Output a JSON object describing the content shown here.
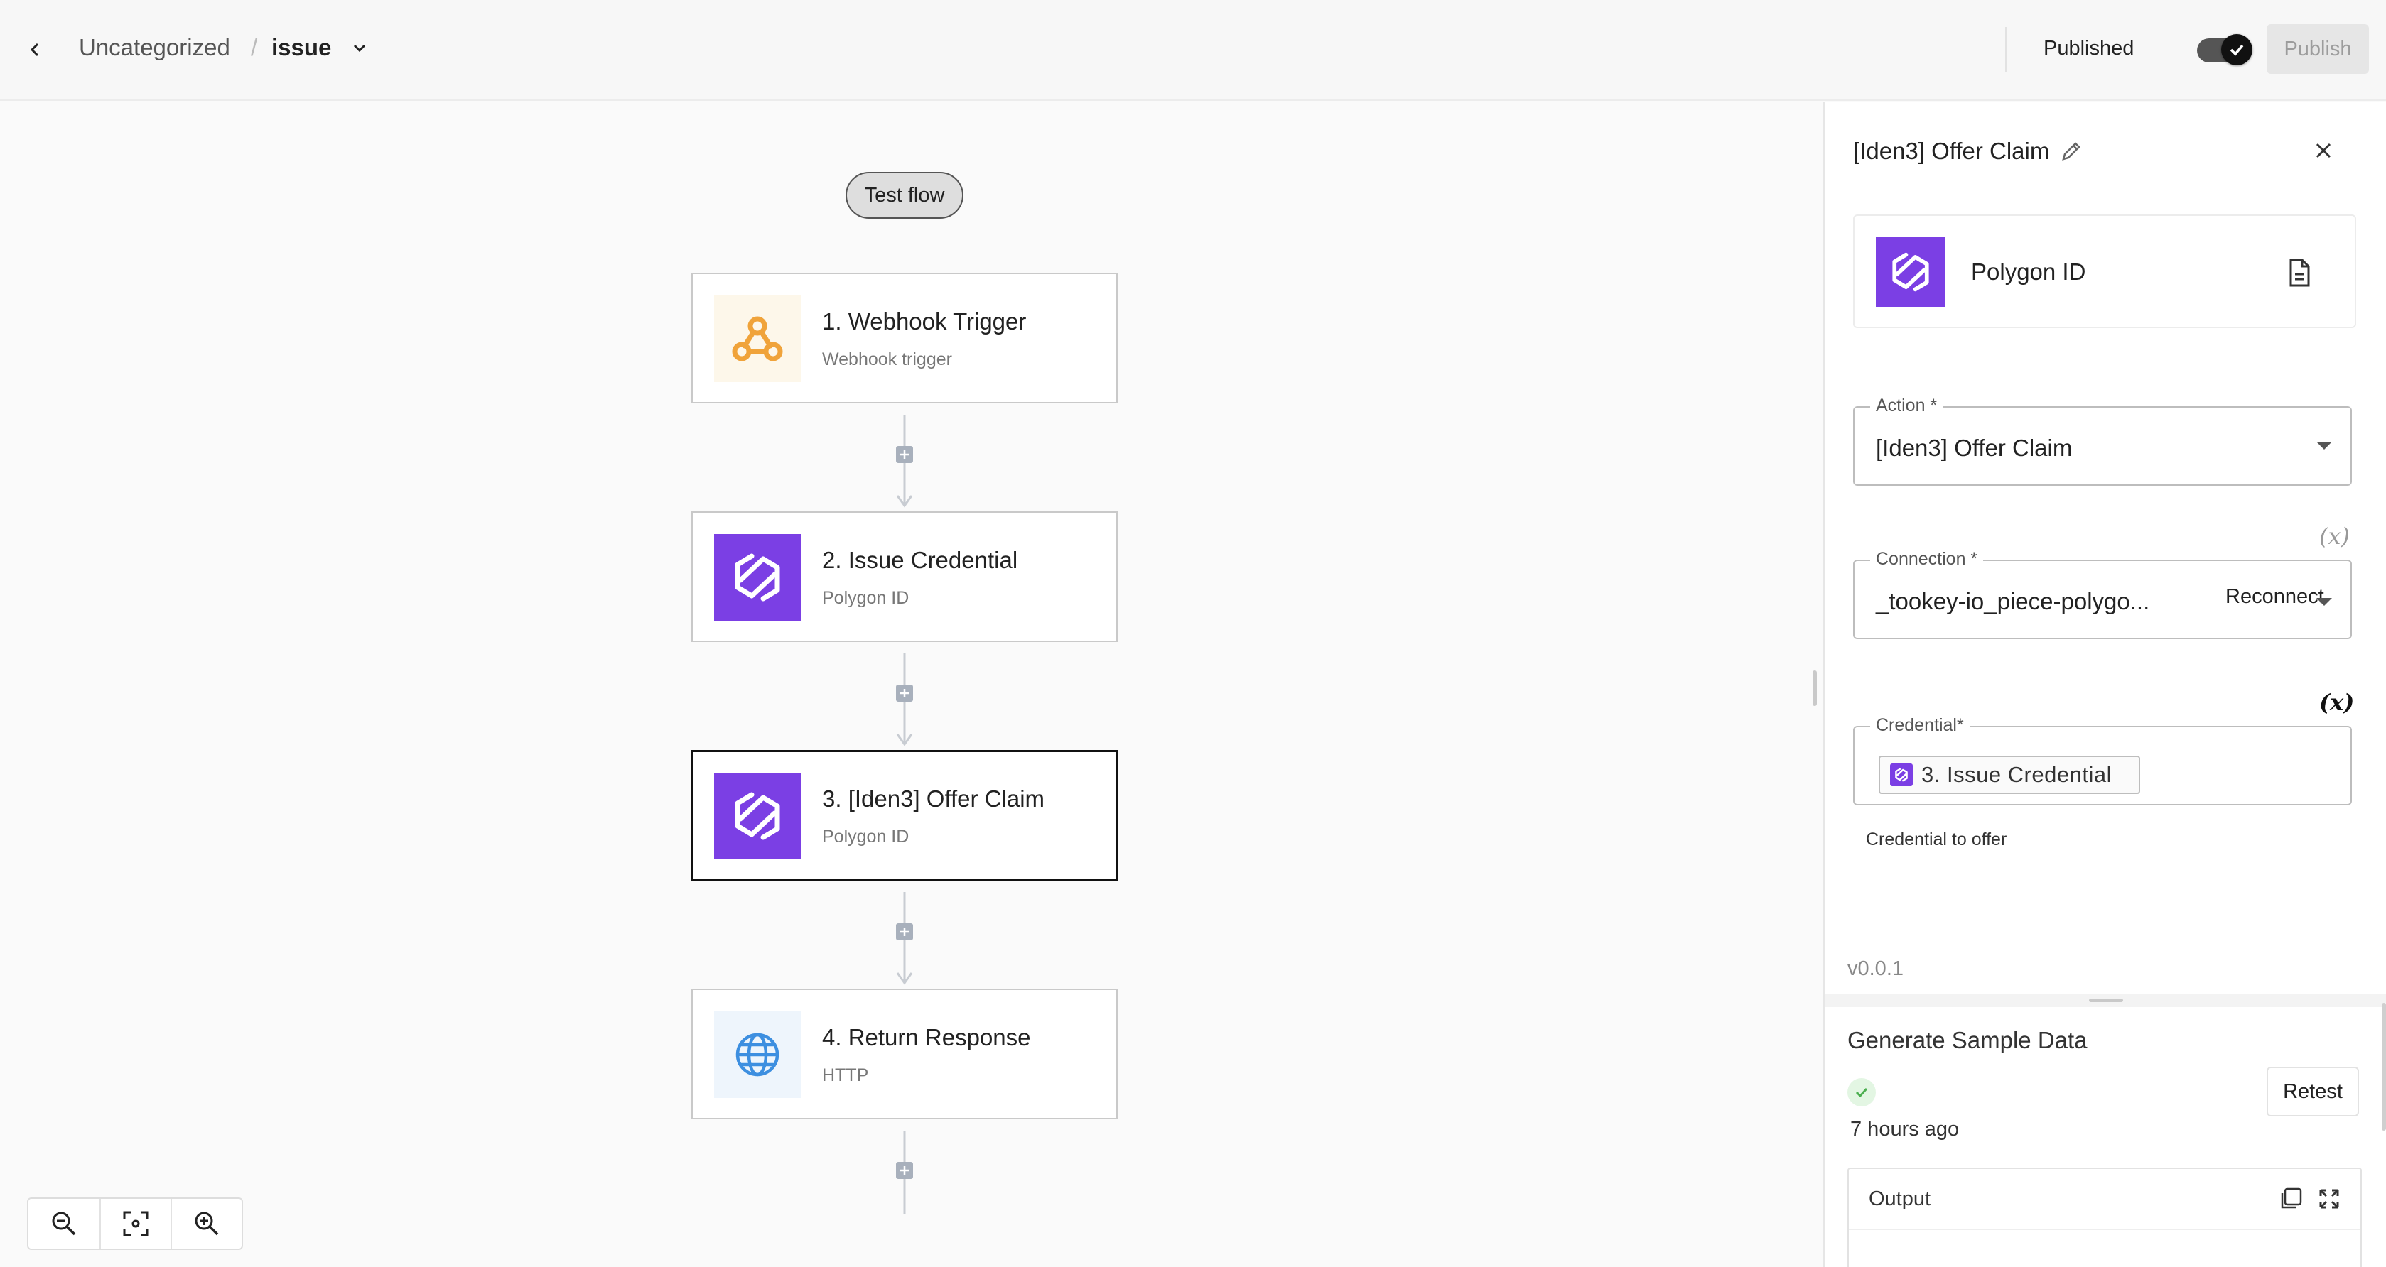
{
  "header": {
    "folder": "Uncategorized",
    "separator": "/",
    "flow_name": "issue",
    "status": "Published",
    "publish_label": "Publish"
  },
  "canvas": {
    "test_flow_label": "Test flow",
    "steps": [
      {
        "title": "1. Webhook Trigger",
        "subtitle": "Webhook trigger",
        "icon": "webhook-icon"
      },
      {
        "title": "2. Issue Credential",
        "subtitle": "Polygon ID",
        "icon": "polygon-id-icon"
      },
      {
        "title": "3. [Iden3] Offer Claim",
        "subtitle": "Polygon ID",
        "icon": "polygon-id-icon"
      },
      {
        "title": "4. Return Response",
        "subtitle": "HTTP",
        "icon": "globe-icon"
      }
    ]
  },
  "panel": {
    "title": "[Iden3] Offer Claim",
    "piece_name": "Polygon ID",
    "action_label": "Action *",
    "action_value": "[Iden3] Offer Claim",
    "connection_label": "Connection *",
    "connection_value": "_tookey-io_piece-polygo...",
    "reconnect_label": "Reconnect",
    "credential_label": "Credential*",
    "credential_chip": "3. Issue Credential",
    "credential_help": "Credential to offer",
    "var_toggle": "(x)",
    "version": "v0.0.1",
    "sample_title": "Generate Sample Data",
    "sample_time": "7 hours ago",
    "retest_label": "Retest",
    "output_label": "Output"
  },
  "colors": {
    "polygon_purple": "#7b3fe4",
    "webhook_orange": "#f0a33a",
    "http_blue": "#3d8fe0",
    "success_green": "#4caf50"
  }
}
